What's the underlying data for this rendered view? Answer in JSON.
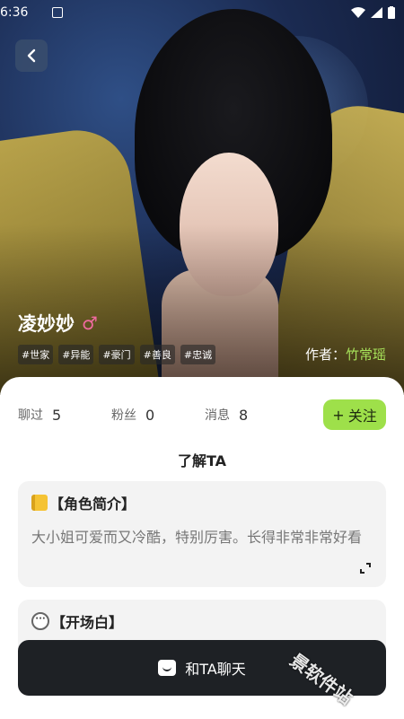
{
  "status_bar": {
    "time": "6:36"
  },
  "character": {
    "name": "凌妙妙",
    "gender_icon": "male-symbol-icon",
    "tags": [
      "#世家",
      "#异能",
      "#豪门",
      "#善良",
      "#忠诚"
    ],
    "author_label": "作者：",
    "author_name": "竹常瑶"
  },
  "stats": [
    {
      "label": "聊过",
      "value": "5"
    },
    {
      "label": "粉丝",
      "value": "0"
    },
    {
      "label": "消息",
      "value": "8"
    }
  ],
  "follow_button": {
    "icon": "+",
    "label": "关注"
  },
  "section_title": "了解TA",
  "intro_card": {
    "title": "【角色简介】",
    "text": "大小姐可爱而又冷酷，特别厉害。长得非常非常好看"
  },
  "opening_card": {
    "title": "【开场白】"
  },
  "chat_button": {
    "label": "和TA聊天"
  },
  "watermark": "景软件站",
  "colors": {
    "accent_green": "#9ee04a",
    "author_green": "#a7e25a",
    "dark_button": "#1e2125"
  }
}
